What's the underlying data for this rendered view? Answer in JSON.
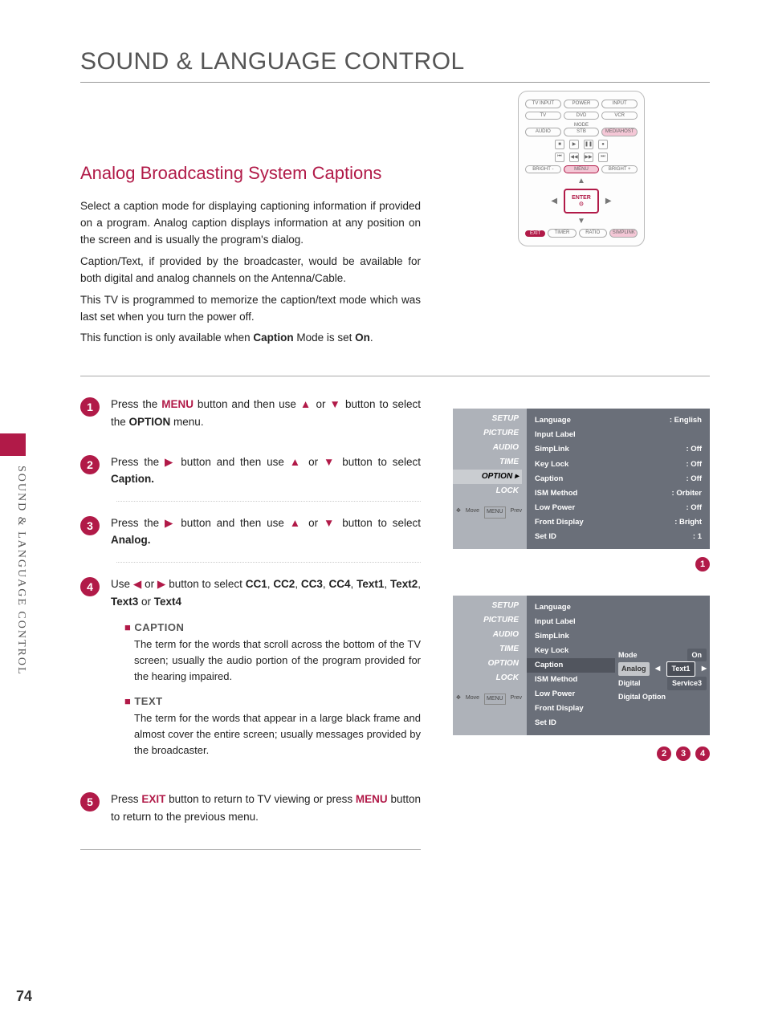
{
  "page_number": "74",
  "side_label": "SOUND & LANGUAGE CONTROL",
  "title": "SOUND & LANGUAGE CONTROL",
  "section_title": "Analog Broadcasting System Captions",
  "intro": {
    "p1": "Select a caption mode for displaying captioning information if provided on a program. Analog caption displays information at any position on the screen and is usually the program's dialog.",
    "p2": "Caption/Text, if provided by the broadcaster, would be available for both digital and analog channels on the Antenna/Cable.",
    "p3": "This TV is programmed to memorize the caption/text mode which was last set when you turn the power off.",
    "p4_pre": "This function is only available when ",
    "p4_bold1": "Caption",
    "p4_mid": " Mode is set ",
    "p4_bold2": "On",
    "p4_post": "."
  },
  "steps": {
    "s1_pre": "Press the ",
    "s1_menu": "MENU",
    "s1_mid": " button and then use ",
    "s1_mid2": " or ",
    "s1_post": " button to select the ",
    "s1_option": "OPTION",
    "s1_end": " menu.",
    "s2_pre": "Press the ",
    "s2_mid": " button and then use ",
    "s2_mid2": " or ",
    "s2_post": " button to select ",
    "s2_caption": "Caption.",
    "s3_pre": "Press the ",
    "s3_mid": " button and then use ",
    "s3_mid2": " or ",
    "s3_post": " button to select ",
    "s3_analog": "Analog.",
    "s4_pre": "Use ",
    "s4_mid": " or ",
    "s4_post": " button to select ",
    "s4_trail": " or ",
    "s4_opts": [
      "CC1",
      "CC2",
      "CC3",
      "CC4",
      "Text1",
      "Text2",
      "Text3",
      "Text4"
    ],
    "s5_pre": "Press ",
    "s5_exit": "EXIT",
    "s5_mid": " button to return to TV viewing or press ",
    "s5_menu": "MENU",
    "s5_post": " button to return to the previous menu."
  },
  "defs": {
    "caption_head": "CAPTION",
    "caption_body": "The term for the words that scroll across the bottom of the TV screen; usually the audio portion of the program provided for the hearing impaired.",
    "text_head": "TEXT",
    "text_body": "The term for the words that appear in a large black frame and almost cover the entire screen; usually messages provided by the broadcaster."
  },
  "remote": {
    "tv_input": "TV INPUT",
    "power": "POWER",
    "input": "INPUT",
    "tv": "TV",
    "dvd": "DVD",
    "vcr": "VCR",
    "mode": "MODE",
    "audio": "AUDIO",
    "stb": "STB",
    "mediahost": "MEDIAHOST",
    "bright_minus": "BRIGHT -",
    "menu": "MENU",
    "bright_plus": "BRIGHT +",
    "enter": "ENTER",
    "exit": "EXIT",
    "timer": "TIMER",
    "ratio": "RATIO",
    "simplink": "SIMPLINK"
  },
  "osd1": {
    "tabs": [
      "SETUP",
      "PICTURE",
      "AUDIO",
      "TIME",
      "OPTION",
      "LOCK"
    ],
    "selected_tab": "OPTION",
    "move": "Move",
    "prev": "Prev",
    "rows": [
      {
        "label": "Language",
        "value": ": English"
      },
      {
        "label": "Input Label",
        "value": ""
      },
      {
        "label": "SimpLink",
        "value": ": Off"
      },
      {
        "label": "Key Lock",
        "value": ": Off"
      },
      {
        "label": "Caption",
        "value": ": Off"
      },
      {
        "label": "ISM Method",
        "value": ": Orbiter"
      },
      {
        "label": "Low Power",
        "value": ": Off"
      },
      {
        "label": "Front Display",
        "value": ": Bright"
      },
      {
        "label": "Set ID",
        "value": ": 1"
      }
    ]
  },
  "osd2": {
    "tabs": [
      "SETUP",
      "PICTURE",
      "AUDIO",
      "TIME",
      "OPTION",
      "LOCK"
    ],
    "move": "Move",
    "prev": "Prev",
    "left_rows": [
      "Language",
      "Input Label",
      "SimpLink",
      "Key Lock",
      "Caption",
      "ISM Method",
      "Low Power",
      "Front Display",
      "Set ID"
    ],
    "selected_left": "Caption",
    "right_rows": [
      {
        "label": "Mode",
        "value": "On"
      },
      {
        "label": "Analog",
        "value": "Text1"
      },
      {
        "label": "Digital",
        "value": "Service3"
      },
      {
        "label": "Digital Option",
        "value": ""
      }
    ],
    "selected_right": "Analog"
  },
  "badge_numbers": {
    "b1": "1",
    "b2": "2",
    "b3": "3",
    "b4": "4",
    "b5": "5"
  }
}
